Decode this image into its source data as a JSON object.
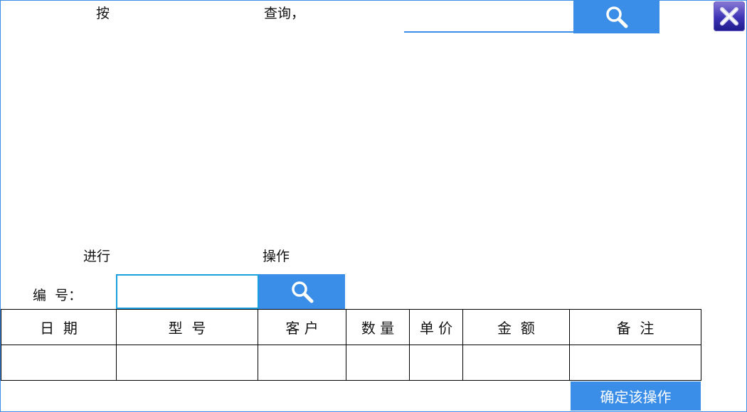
{
  "colors": {
    "accent": "#3b8ee8",
    "input_border": "#1aa0e0",
    "close_button": "#3d33b5"
  },
  "query_bar": {
    "label_an": "按",
    "label_query": "查询，",
    "search_value": "",
    "search_icon": "search-icon"
  },
  "close_icon": "close-icon",
  "operation_bar": {
    "label_do": "进行",
    "label_op": "操作"
  },
  "id_field": {
    "label": "编  号：",
    "value": "",
    "search_icon": "search-icon"
  },
  "table": {
    "columns": [
      "日  期",
      "型  号",
      "客 户",
      "数 量",
      "单 价",
      "金  额",
      "备  注"
    ],
    "rows": [
      [
        "",
        "",
        "",
        "",
        "",
        "",
        ""
      ]
    ]
  },
  "confirm_button": {
    "label": "确定该操作"
  }
}
